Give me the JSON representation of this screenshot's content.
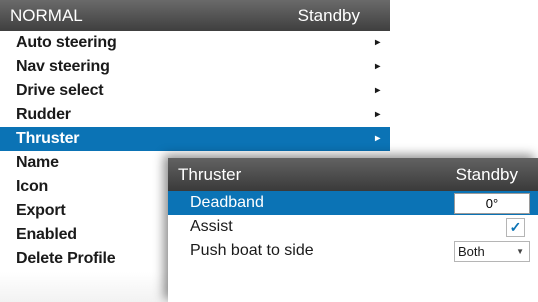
{
  "back_panel": {
    "title": "NORMAL",
    "status": "Standby",
    "items": [
      {
        "label": "Auto steering",
        "arrow": "▸"
      },
      {
        "label": "Nav steering",
        "arrow": "▸"
      },
      {
        "label": "Drive select",
        "arrow": "▸"
      },
      {
        "label": "Rudder",
        "arrow": "▸"
      },
      {
        "label": "Thruster",
        "arrow": "▸"
      },
      {
        "label": "Name"
      },
      {
        "label": "Icon"
      },
      {
        "label": "Export"
      },
      {
        "label": "Enabled"
      },
      {
        "label": "Delete Profile"
      }
    ],
    "selected_index": 4
  },
  "dialog": {
    "title": "Thruster",
    "status": "Standby",
    "deadband": {
      "label": "Deadband",
      "value": "0°"
    },
    "assist": {
      "label": "Assist",
      "checked": true,
      "check": "✓"
    },
    "push": {
      "label": "Push boat to side",
      "value": "Both",
      "chevron": "▼"
    }
  },
  "colors": {
    "accent": "#0b73b5",
    "header": "#4a4a4a"
  }
}
